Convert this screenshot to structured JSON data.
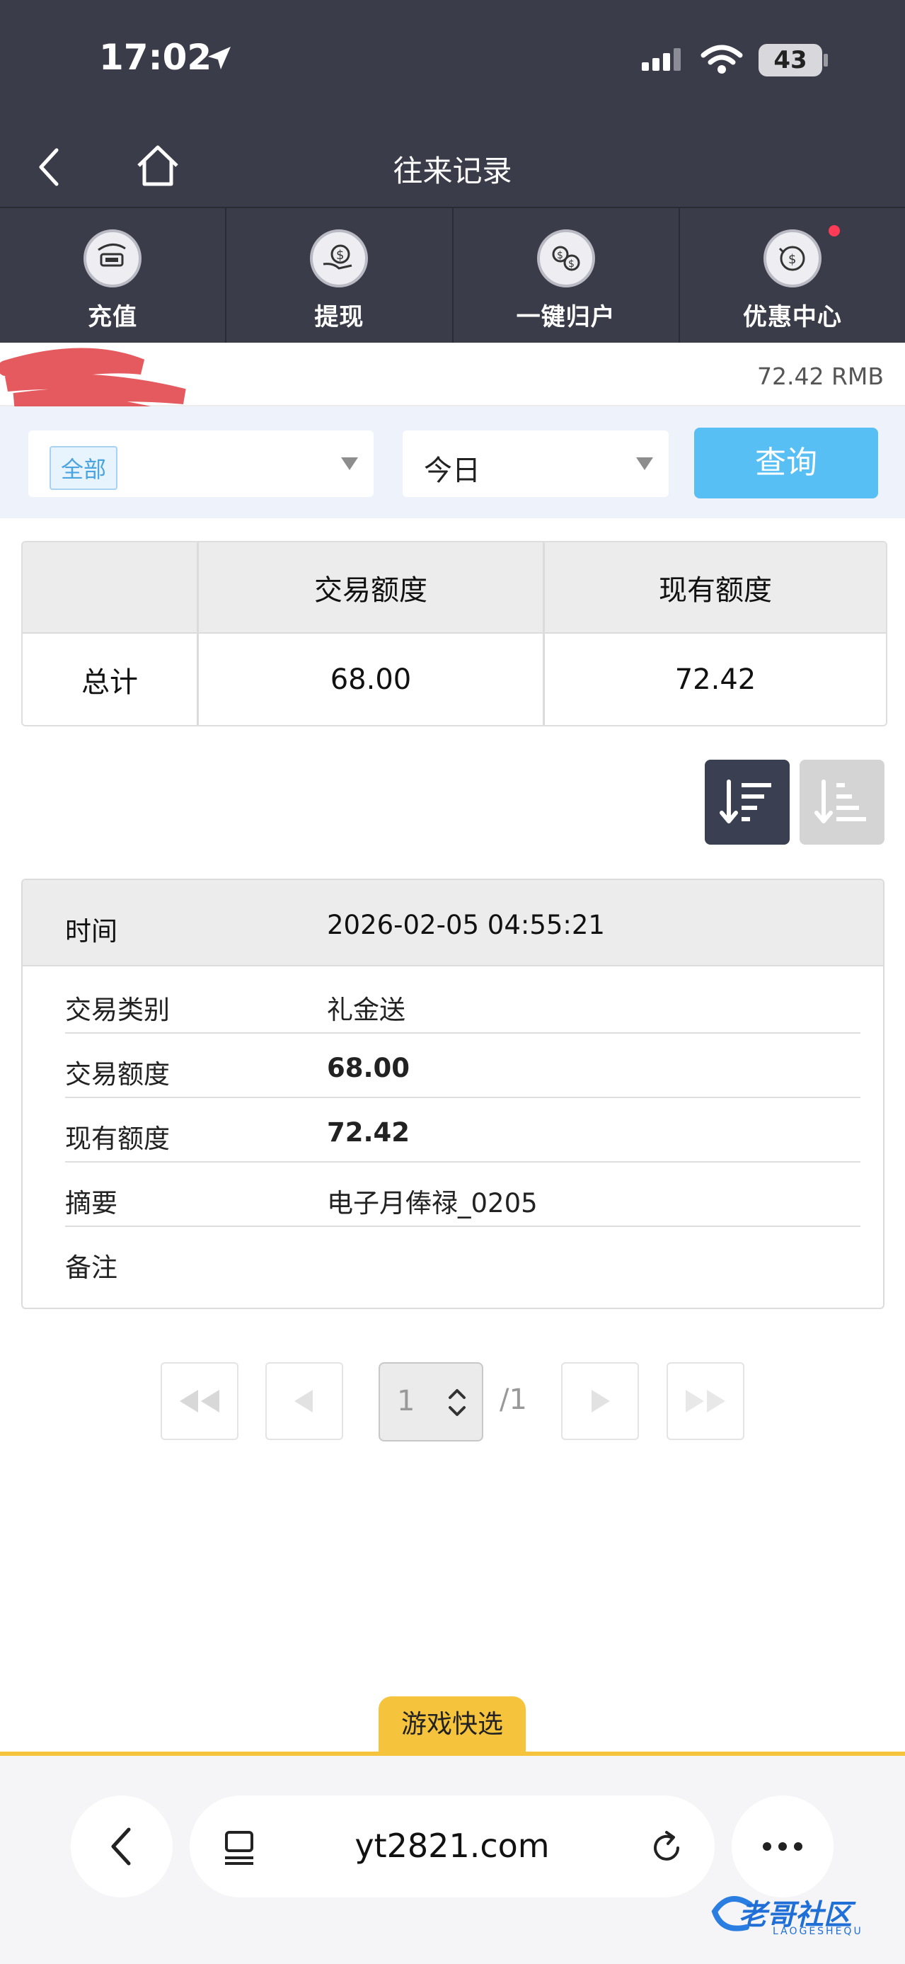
{
  "status_bar": {
    "time": "17:02",
    "battery": "43"
  },
  "header": {
    "title": "往来记录"
  },
  "quick_nav": [
    {
      "label": "充值",
      "icon": "recharge-icon"
    },
    {
      "label": "提现",
      "icon": "withdraw-icon"
    },
    {
      "label": "一键归户",
      "icon": "transfer-icon"
    },
    {
      "label": "优惠中心",
      "icon": "promotion-icon"
    }
  ],
  "balance": {
    "amount": "72.42 RMB"
  },
  "filters": {
    "type_value": "全部",
    "range_value": "今日",
    "query_label": "查询"
  },
  "summary": {
    "headers": [
      "",
      "交易额度",
      "现有额度"
    ],
    "row_label": "总计",
    "transaction_amount": "68.00",
    "current_amount": "72.42"
  },
  "record": {
    "time_label": "时间",
    "time_value": "2026-02-05 04:55:21",
    "type_label": "交易类别",
    "type_value": "礼金送",
    "amount_label": "交易额度",
    "amount_value": "68.00",
    "current_label": "现有额度",
    "current_value": "72.42",
    "summary_label": "摘要",
    "summary_value": "电子月俸禄_0205",
    "note_label": "备注",
    "note_value": ""
  },
  "pagination": {
    "current_page": "1",
    "total": "/1"
  },
  "game_tab": {
    "label": "游戏快选"
  },
  "browser": {
    "url": "yt2821.com"
  },
  "watermark": {
    "text": "老哥社区",
    "sub": "LAOGESHEQU"
  },
  "colors": {
    "header_bg": "#3b3c49",
    "query_btn": "#58bff5",
    "accent_yellow": "#f5c33c"
  }
}
